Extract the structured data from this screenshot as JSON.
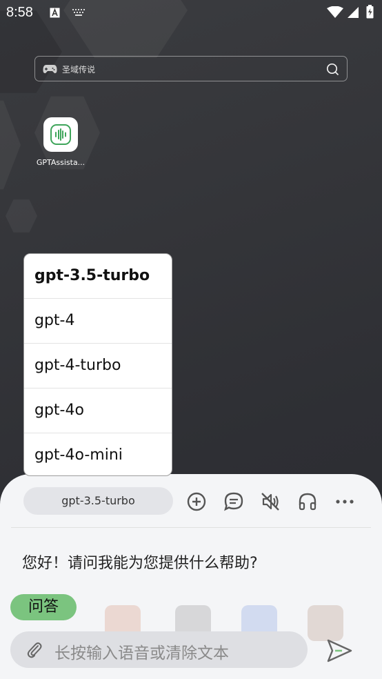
{
  "status_bar": {
    "time": "8:58"
  },
  "search": {
    "text": "圣域传说"
  },
  "app": {
    "label": "GPTAssista..."
  },
  "model_menu": {
    "items": [
      "gpt-3.5-turbo",
      "gpt-4",
      "gpt-4-turbo",
      "gpt-4o",
      "gpt-4o-mini"
    ],
    "selected": "gpt-3.5-turbo"
  },
  "panel": {
    "current_model": "gpt-3.5-turbo",
    "greeting": "您好！请问我能为您提供什么帮助?",
    "mode": "问答",
    "input_placeholder": "长按输入语音或清除文本"
  },
  "colors": {
    "accent": "#7bc47f",
    "icon": "#3ea55a"
  },
  "icons": [
    "keyboard-a-icon",
    "keyboard-icon",
    "wifi-icon",
    "signal-icon",
    "battery-icon",
    "gamepad-icon",
    "search-icon",
    "add-circle-icon",
    "chat-bubble-icon",
    "volume-off-icon",
    "headphones-icon",
    "more-icon",
    "attach-icon",
    "send-icon"
  ]
}
